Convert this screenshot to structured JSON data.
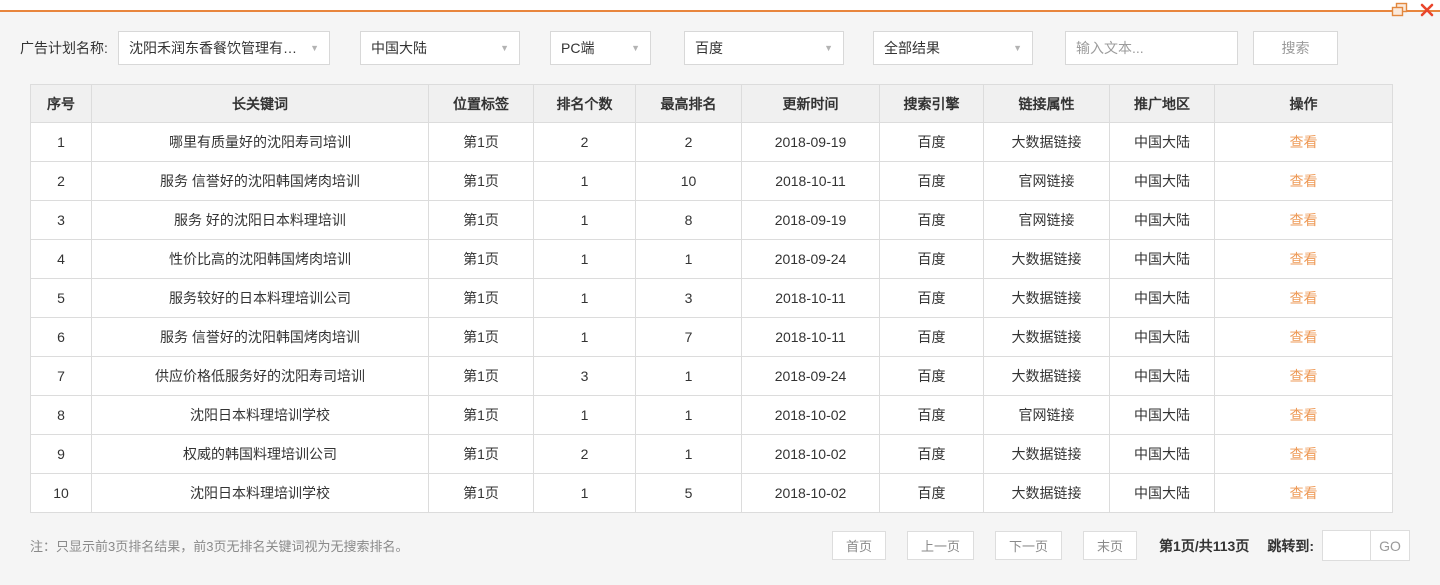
{
  "window": {
    "restore_icon": "restore-window",
    "close_icon": "close-window"
  },
  "filters": {
    "label": "广告计划名称:",
    "selects": [
      {
        "value": "沈阳禾润东香餐饮管理有限公..."
      },
      {
        "value": "中国大陆"
      },
      {
        "value": "PC端"
      },
      {
        "value": "百度"
      },
      {
        "value": "全部结果"
      }
    ],
    "search_placeholder": "输入文本...",
    "search_button": "搜索"
  },
  "table": {
    "headers": [
      "序号",
      "长关键词",
      "位置标签",
      "排名个数",
      "最高排名",
      "更新时间",
      "搜索引擎",
      "链接属性",
      "推广地区",
      "操作"
    ],
    "action_label": "查看",
    "rows": [
      [
        "1",
        "哪里有质量好的沈阳寿司培训",
        "第1页",
        "2",
        "2",
        "2018-09-19",
        "百度",
        "大数据链接",
        "中国大陆"
      ],
      [
        "2",
        "服务 信誉好的沈阳韩国烤肉培训",
        "第1页",
        "1",
        "10",
        "2018-10-11",
        "百度",
        "官网链接",
        "中国大陆"
      ],
      [
        "3",
        "服务 好的沈阳日本料理培训",
        "第1页",
        "1",
        "8",
        "2018-09-19",
        "百度",
        "官网链接",
        "中国大陆"
      ],
      [
        "4",
        "性价比高的沈阳韩国烤肉培训",
        "第1页",
        "1",
        "1",
        "2018-09-24",
        "百度",
        "大数据链接",
        "中国大陆"
      ],
      [
        "5",
        "服务较好的日本料理培训公司",
        "第1页",
        "1",
        "3",
        "2018-10-11",
        "百度",
        "大数据链接",
        "中国大陆"
      ],
      [
        "6",
        "服务 信誉好的沈阳韩国烤肉培训",
        "第1页",
        "1",
        "7",
        "2018-10-11",
        "百度",
        "大数据链接",
        "中国大陆"
      ],
      [
        "7",
        "供应价格低服务好的沈阳寿司培训",
        "第1页",
        "3",
        "1",
        "2018-09-24",
        "百度",
        "大数据链接",
        "中国大陆"
      ],
      [
        "8",
        "沈阳日本料理培训学校",
        "第1页",
        "1",
        "1",
        "2018-10-02",
        "百度",
        "官网链接",
        "中国大陆"
      ],
      [
        "9",
        "权威的韩国料理培训公司",
        "第1页",
        "2",
        "1",
        "2018-10-02",
        "百度",
        "大数据链接",
        "中国大陆"
      ],
      [
        "10",
        "沈阳日本料理培训学校",
        "第1页",
        "1",
        "5",
        "2018-10-02",
        "百度",
        "大数据链接",
        "中国大陆"
      ]
    ]
  },
  "footer": {
    "note": "注：只显示前3页排名结果，前3页无排名关键词视为无搜索排名。",
    "pagination": {
      "first": "首页",
      "prev": "上一页",
      "next": "下一页",
      "last": "末页",
      "page_info": "第1页/共113页",
      "jump_label": "跳转到:",
      "jump_value": "",
      "go": "GO"
    }
  },
  "colors": {
    "accent_orange": "#e8853d",
    "close_red": "#e9452c",
    "view_link": "#ee9a57",
    "header_bg": "#f0f0f0",
    "page_bg": "#f5f5f5",
    "border": "#dcdcdc"
  }
}
